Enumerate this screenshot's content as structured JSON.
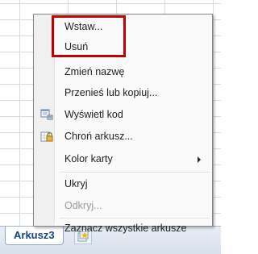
{
  "context_menu": {
    "items": [
      {
        "label": "Wstaw...",
        "enabled": true
      },
      {
        "label": "Usuń",
        "enabled": true
      },
      {
        "label": "Zmień nazwę",
        "enabled": true
      },
      {
        "label": "Przenieś lub kopiuj...",
        "enabled": true
      },
      {
        "label": "Wyświetl kod",
        "enabled": true,
        "icon": "view-code-icon"
      },
      {
        "label": "Chroń arkusz...",
        "enabled": true,
        "icon": "protect-sheet-icon"
      },
      {
        "label": "Kolor karty",
        "enabled": true,
        "submenu": true
      },
      {
        "label": "Ukryj",
        "enabled": true
      },
      {
        "label": "Odkryj...",
        "enabled": false
      },
      {
        "label": "Zaznacz wszystkie arkusze",
        "enabled": true
      }
    ]
  },
  "sheet_tabs": {
    "active_tab_label": "Arkusz3"
  },
  "colors": {
    "highlight_border": "#c00000",
    "tab_text": "#15428b",
    "disabled_text": "#9b9b9b"
  }
}
